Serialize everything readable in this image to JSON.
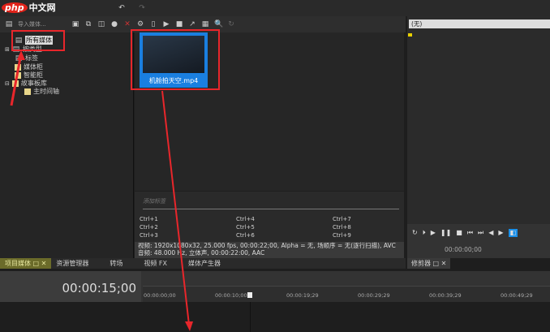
{
  "watermark": "php中文网",
  "toolbar": {
    "import_label": "导入媒体..."
  },
  "tree": {
    "items": [
      {
        "label": "所有媒体"
      },
      {
        "label": "按类型"
      },
      {
        "label": "标签"
      },
      {
        "label": "媒体柜"
      },
      {
        "label": "智能柜"
      },
      {
        "label": "故事板库"
      },
      {
        "label": "主时间轴"
      }
    ]
  },
  "clip": {
    "name": "机舱拍天空.mp4"
  },
  "tags": {
    "placeholder": "添加标签",
    "shortcuts": [
      "Ctrl+1",
      "Ctrl+2",
      "Ctrl+3",
      "Ctrl+4",
      "Ctrl+5",
      "Ctrl+6",
      "Ctrl+7",
      "Ctrl+8",
      "Ctrl+9"
    ]
  },
  "status": {
    "video": "视频: 1920x1080x32, 25.000 fps, 00:00:22;00, Alpha = 无, 场顺序 = 无(逐行扫描), AVC",
    "audio": "音频: 48.000 Hz, 立体声, 00:00:22:00, AAC"
  },
  "tabs": [
    {
      "label": "项目媒体"
    },
    {
      "label": "资源管理器"
    },
    {
      "label": "转场"
    },
    {
      "label": "视频 FX"
    },
    {
      "label": "媒体产生器"
    }
  ],
  "trimmer": {
    "dropdown": "(无)",
    "time": "00:00:00;00",
    "tab": "修剪器"
  },
  "timeline": {
    "timecode": "00:00:15;00",
    "ruler": [
      "00:00:00;00",
      "00:00:10;00",
      "00:00:19;29",
      "00:00:29;29",
      "00:00:39;29",
      "00:00:49;29"
    ]
  },
  "colors": {
    "accent": "#1a7fe0",
    "annotation": "#e8262b"
  }
}
